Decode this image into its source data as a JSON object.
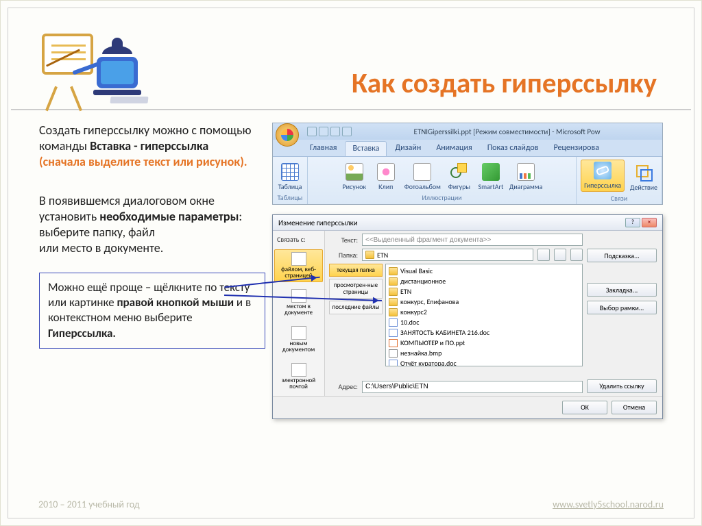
{
  "title": "Как создать гиперссылку",
  "para1": {
    "t1": "Создать гиперссылку можно с помощью команды ",
    "b1": "Вставка  - гиперссылка",
    "note": "(сначала выделите текст или рисунок)."
  },
  "para2": {
    "t1": "В появившемся диалоговом окне установить ",
    "b1": "необходимые параметры",
    "t2": ": выберите папку, файл",
    "t3": "или место в документе."
  },
  "tip": {
    "t1": "Можно ещё проще – щёлкните по тексту или картинке ",
    "b1": "правой кнопкой мыши",
    "t2": " и в контекстном меню выберите ",
    "b2": "Гиперссылка."
  },
  "ribbon": {
    "wintitle": "ETNIGiperssilki.ppt [Режим совместимости] - Microsoft Pow",
    "tabs": [
      "Главная",
      "Вставка",
      "Дизайн",
      "Анимация",
      "Показ слайдов",
      "Рецензирова"
    ],
    "groups": {
      "tables": {
        "label": "Таблицы",
        "items": [
          "Таблица"
        ]
      },
      "illus": {
        "label": "Иллюстрации",
        "items": [
          "Рисунок",
          "Клип",
          "Фотоальбом",
          "Фигуры",
          "SmartArt",
          "Диаграмма"
        ]
      },
      "links": {
        "label": "Связи",
        "items": [
          "Гиперссылка",
          "Действие"
        ]
      }
    }
  },
  "dialog": {
    "title": "Изменение гиперссылки",
    "linkWith": "Связать с:",
    "textLabel": "Текст:",
    "textValue": "<<Выделенный фрагмент документа>>",
    "folderLabel": "Папка:",
    "folderValue": "ETN",
    "linkTargets": [
      "файлом, веб-страницей",
      "местом в документе",
      "новым документом",
      "электронной почтой"
    ],
    "browseNav": [
      "текущая папка",
      "просмотрен-ные страницы",
      "последние файлы"
    ],
    "files": [
      {
        "icon": "fold",
        "name": "Visual Basic"
      },
      {
        "icon": "fold",
        "name": "дистанционное"
      },
      {
        "icon": "fold",
        "name": "ETN"
      },
      {
        "icon": "fold",
        "name": "конкурс, Епифанова"
      },
      {
        "icon": "fold",
        "name": "конкурс2"
      },
      {
        "icon": "doc",
        "name": "10.doc"
      },
      {
        "icon": "doc",
        "name": "ЗАНЯТОСТЬ КАБИНЕТА   216.doc"
      },
      {
        "icon": "ppt",
        "name": "КОМПЬЮТЕР и ПО.ppt"
      },
      {
        "icon": "bmp",
        "name": "незнайка.bmp"
      },
      {
        "icon": "doc",
        "name": "Отчёт куратора.doc"
      }
    ],
    "addressLabel": "Адрес:",
    "addressValue": "C:\\Users\\Public\\ETN",
    "btnHint": "Подсказка...",
    "btnBookmark": "Закладка...",
    "btnFrame": "Выбор рамки...",
    "btnRemove": "Удалить ссылку",
    "btnOk": "OK",
    "btnCancel": "Отмена"
  },
  "footer": {
    "year": "2010 – 2011 учебный год",
    "url": "www.svetly5school.narod.ru"
  }
}
